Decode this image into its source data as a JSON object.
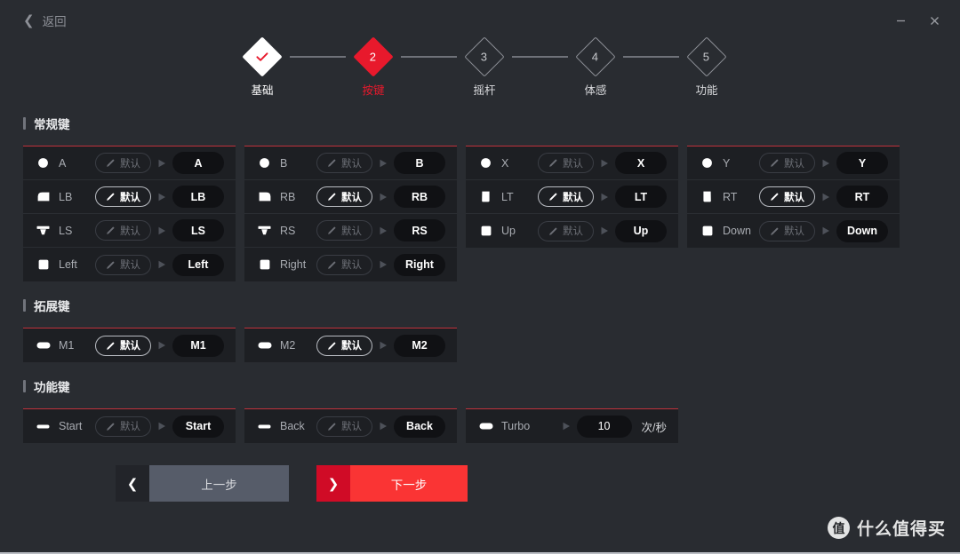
{
  "titlebar": {
    "back_label": "返回",
    "back_icon": "chevron-left-icon",
    "minimize_icon": "minimize-icon",
    "close_icon": "close-icon"
  },
  "stepper": {
    "steps": [
      {
        "num": "✓",
        "label": "基础",
        "state": "done"
      },
      {
        "num": "2",
        "label": "按键",
        "state": "active"
      },
      {
        "num": "3",
        "label": "摇杆",
        "state": "todo"
      },
      {
        "num": "4",
        "label": "体感",
        "state": "todo"
      },
      {
        "num": "5",
        "label": "功能",
        "state": "todo"
      }
    ],
    "active_color": "#e8192c"
  },
  "sections": [
    {
      "title": "常规键",
      "columns": [
        {
          "rows": [
            {
              "icon": "circle-button-icon",
              "label": "A",
              "pill": "默认",
              "pill_highlight": false,
              "value": "A"
            },
            {
              "icon": "bumper-left-icon",
              "label": "LB",
              "pill": "默认",
              "pill_highlight": true,
              "value": "LB"
            },
            {
              "icon": "stick-icon",
              "label": "LS",
              "pill": "默认",
              "pill_highlight": false,
              "value": "LS"
            },
            {
              "icon": "dpad-left-icon",
              "label": "Left",
              "pill": "默认",
              "pill_highlight": false,
              "value": "Left"
            }
          ]
        },
        {
          "rows": [
            {
              "icon": "circle-button-icon",
              "label": "B",
              "pill": "默认",
              "pill_highlight": false,
              "value": "B"
            },
            {
              "icon": "bumper-right-icon",
              "label": "RB",
              "pill": "默认",
              "pill_highlight": true,
              "value": "RB"
            },
            {
              "icon": "stick-icon",
              "label": "RS",
              "pill": "默认",
              "pill_highlight": false,
              "value": "RS"
            },
            {
              "icon": "dpad-right-icon",
              "label": "Right",
              "pill": "默认",
              "pill_highlight": false,
              "value": "Right"
            }
          ]
        },
        {
          "rows": [
            {
              "icon": "circle-button-icon",
              "label": "X",
              "pill": "默认",
              "pill_highlight": false,
              "value": "X"
            },
            {
              "icon": "trigger-left-icon",
              "label": "LT",
              "pill": "默认",
              "pill_highlight": true,
              "value": "LT"
            },
            {
              "icon": "dpad-up-icon",
              "label": "Up",
              "pill": "默认",
              "pill_highlight": false,
              "value": "Up"
            }
          ]
        },
        {
          "rows": [
            {
              "icon": "circle-button-icon",
              "label": "Y",
              "pill": "默认",
              "pill_highlight": false,
              "value": "Y"
            },
            {
              "icon": "trigger-right-icon",
              "label": "RT",
              "pill": "默认",
              "pill_highlight": true,
              "value": "RT"
            },
            {
              "icon": "dpad-down-icon",
              "label": "Down",
              "pill": "默认",
              "pill_highlight": false,
              "value": "Down"
            }
          ]
        }
      ]
    },
    {
      "title": "拓展键",
      "columns": [
        {
          "rows": [
            {
              "icon": "paddle-icon",
              "label": "M1",
              "pill": "默认",
              "pill_highlight": true,
              "value": "M1"
            }
          ]
        },
        {
          "rows": [
            {
              "icon": "paddle-icon",
              "label": "M2",
              "pill": "默认",
              "pill_highlight": true,
              "value": "M2"
            }
          ]
        }
      ]
    },
    {
      "title": "功能键",
      "columns": [
        {
          "rows": [
            {
              "icon": "dash-icon",
              "label": "Start",
              "pill": "默认",
              "pill_highlight": false,
              "value": "Start"
            }
          ]
        },
        {
          "rows": [
            {
              "icon": "dash-icon",
              "label": "Back",
              "pill": "默认",
              "pill_highlight": false,
              "value": "Back"
            }
          ]
        },
        {
          "rows": [
            {
              "icon": "paddle-icon",
              "label": "Turbo",
              "pill": null,
              "value": "10",
              "unit": "次/秒"
            }
          ]
        }
      ]
    }
  ],
  "footer": {
    "prev_label": "上一步",
    "prev_icon": "chevron-left-icon",
    "next_label": "下一步",
    "next_icon": "chevron-right-icon"
  },
  "watermark": {
    "logo_char": "值",
    "text": "什么值得买"
  }
}
